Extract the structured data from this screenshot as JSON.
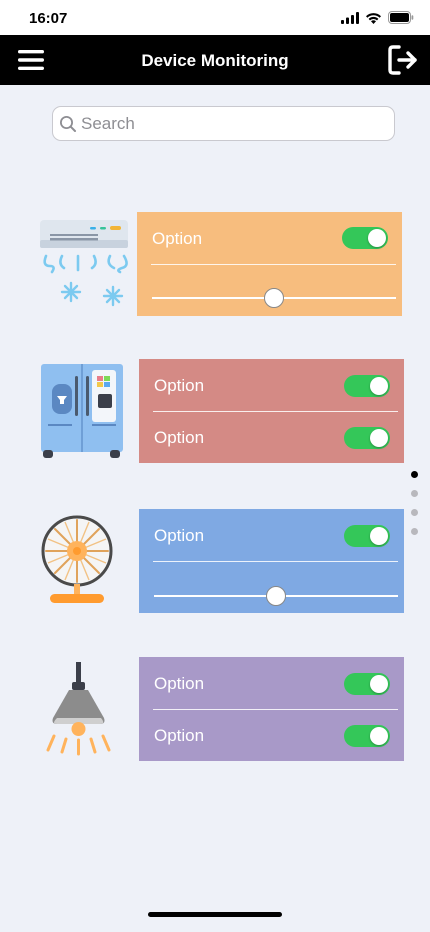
{
  "status_bar": {
    "time": "16:07"
  },
  "header": {
    "title": "Device Monitoring"
  },
  "search": {
    "placeholder": "Search",
    "value": ""
  },
  "devices": [
    {
      "icon": "air-conditioner-icon",
      "color": "#f7bd7e",
      "rows": [
        {
          "label": "Option",
          "toggle": true
        },
        {
          "slider": 0.5
        }
      ]
    },
    {
      "icon": "refrigerator-icon",
      "color": "#d48a85",
      "rows": [
        {
          "label": "Option",
          "toggle": true
        },
        {
          "label": "Option",
          "toggle": true
        }
      ]
    },
    {
      "icon": "fan-icon",
      "color": "#7fa9e3",
      "rows": [
        {
          "label": "Option",
          "toggle": true
        },
        {
          "slider": 0.5
        }
      ]
    },
    {
      "icon": "ceiling-lamp-icon",
      "color": "#a899c8",
      "rows": [
        {
          "label": "Option",
          "toggle": true
        },
        {
          "label": "Option",
          "toggle": true
        }
      ]
    }
  ],
  "pagination": {
    "pages": 4,
    "current": 1
  }
}
